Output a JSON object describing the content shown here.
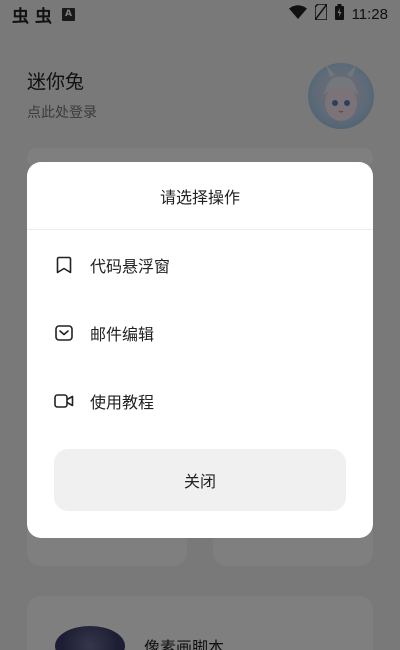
{
  "status_bar": {
    "notifications": [
      "虫",
      "虫"
    ],
    "a_badge": "A",
    "time": "11:28"
  },
  "profile": {
    "name": "迷你兔",
    "login_hint": "点此处登录"
  },
  "cards": {
    "script_title": "像素画脚本"
  },
  "dialog": {
    "title": "请选择操作",
    "items": [
      {
        "label": "代码悬浮窗",
        "icon": "bookmark-icon"
      },
      {
        "label": "邮件编辑",
        "icon": "mail-icon"
      },
      {
        "label": "使用教程",
        "icon": "video-icon"
      }
    ],
    "close_label": "关闭"
  },
  "colors": {
    "overlay": "#000000",
    "dialog_bg": "#ffffff",
    "button_bg": "#f0f0f0"
  }
}
